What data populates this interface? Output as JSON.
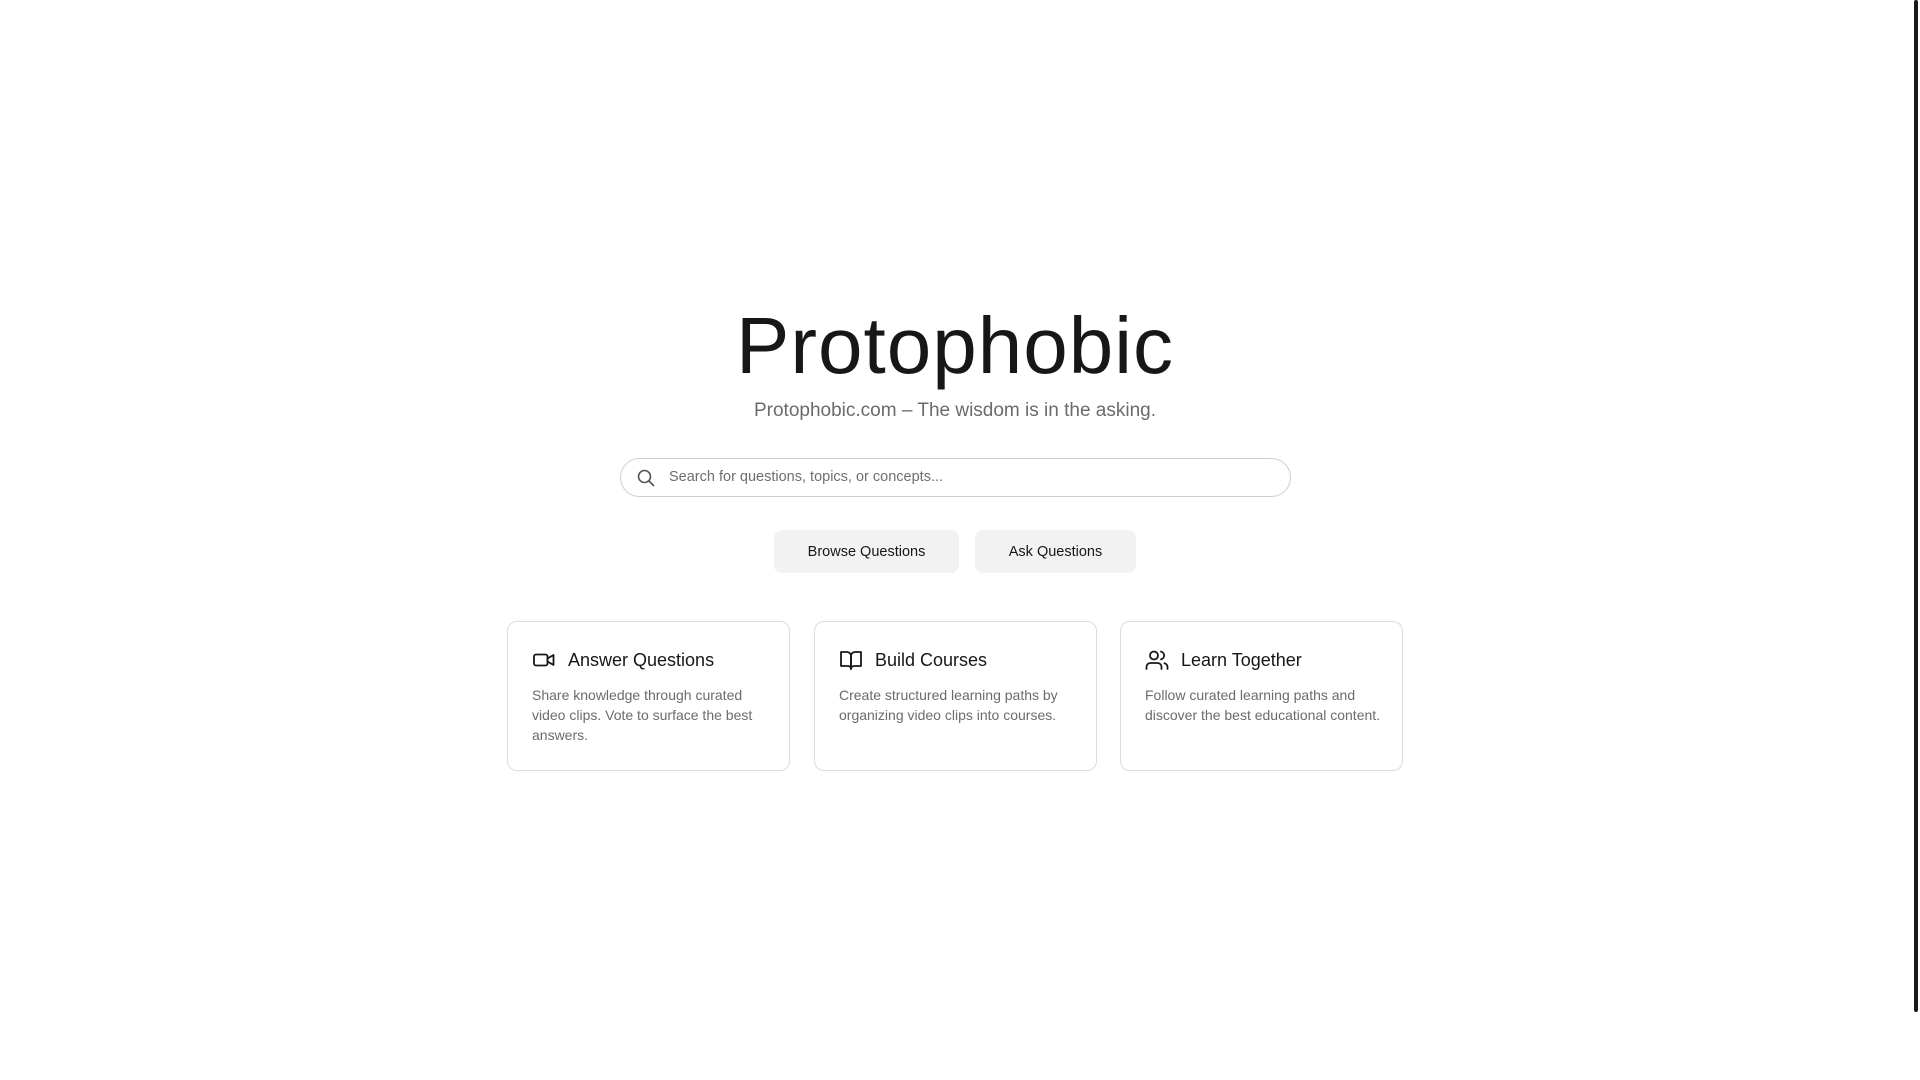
{
  "hero": {
    "title": "Protophobic",
    "subtitle": "Protophobic.com – The wisdom is in the asking."
  },
  "search": {
    "placeholder": "Search for questions, topics, or concepts...",
    "value": "",
    "icon": "search-icon"
  },
  "actions": {
    "browse_label": "Browse Questions",
    "ask_label": "Ask Questions"
  },
  "features": [
    {
      "icon": "video-camera-icon",
      "title": "Answer Questions",
      "description": "Share knowledge through curated video clips. Vote to surface the best answers."
    },
    {
      "icon": "open-book-icon",
      "title": "Build Courses",
      "description": "Create structured learning paths by organizing video clips into courses."
    },
    {
      "icon": "users-icon",
      "title": "Learn Together",
      "description": "Follow curated learning paths and discover the best educational content."
    }
  ],
  "colors": {
    "text": "#171717",
    "muted": "#6b6b6b",
    "button_bg": "#f2f2f2",
    "border": "#dcdcdc"
  }
}
